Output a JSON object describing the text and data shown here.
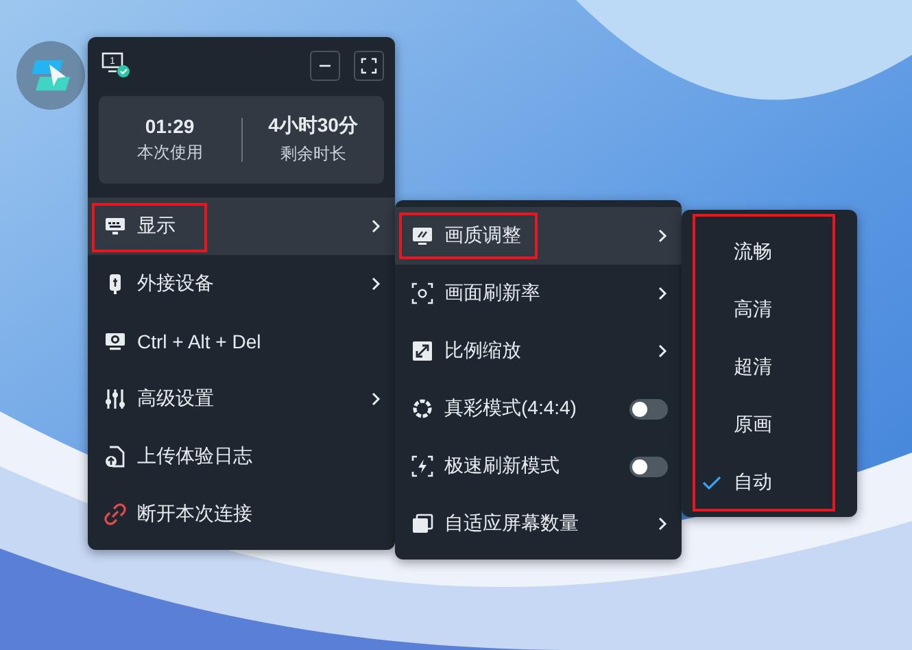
{
  "header": {
    "screen_number": "1"
  },
  "stats": [
    {
      "value": "01:29",
      "label": "本次使用"
    },
    {
      "value": "4小时30分",
      "label": "剩余时长"
    }
  ],
  "menu": [
    {
      "kind": "display",
      "label": "显示",
      "submenu": true,
      "selected": true,
      "highlighted": true
    },
    {
      "kind": "usb",
      "label": "外接设备",
      "submenu": true,
      "selected": false,
      "highlighted": false
    },
    {
      "kind": "cad",
      "label": "Ctrl + Alt + Del",
      "submenu": false,
      "selected": false,
      "highlighted": false
    },
    {
      "kind": "sliders",
      "label": "高级设置",
      "submenu": true,
      "selected": false,
      "highlighted": false
    },
    {
      "kind": "upload",
      "label": "上传体验日志",
      "submenu": false,
      "selected": false,
      "highlighted": false
    },
    {
      "kind": "disconnect",
      "label": "断开本次连接",
      "submenu": false,
      "selected": false,
      "highlighted": false
    }
  ],
  "display_menu": [
    {
      "kind": "quality",
      "label": "画质调整",
      "submenu": true,
      "selected": true,
      "highlighted": true
    },
    {
      "kind": "refresh",
      "label": "画面刷新率",
      "submenu": true,
      "selected": false,
      "highlighted": false
    },
    {
      "kind": "scale",
      "label": "比例缩放",
      "submenu": true,
      "selected": false,
      "highlighted": false
    },
    {
      "kind": "color",
      "label": "真彩模式(4:4:4)",
      "submenu": false,
      "on": false,
      "selected": false,
      "highlighted": false
    },
    {
      "kind": "fast",
      "label": "极速刷新模式",
      "submenu": false,
      "on": false,
      "selected": false,
      "highlighted": false
    },
    {
      "kind": "screens",
      "label": "自适应屏幕数量",
      "submenu": true,
      "selected": false,
      "highlighted": false
    }
  ],
  "quality_menu": {
    "highlighted": true,
    "items": [
      {
        "label": "流畅",
        "checked": false
      },
      {
        "label": "高清",
        "checked": false
      },
      {
        "label": "超清",
        "checked": false
      },
      {
        "label": "原画",
        "checked": false
      },
      {
        "label": "自动",
        "checked": true
      }
    ]
  }
}
